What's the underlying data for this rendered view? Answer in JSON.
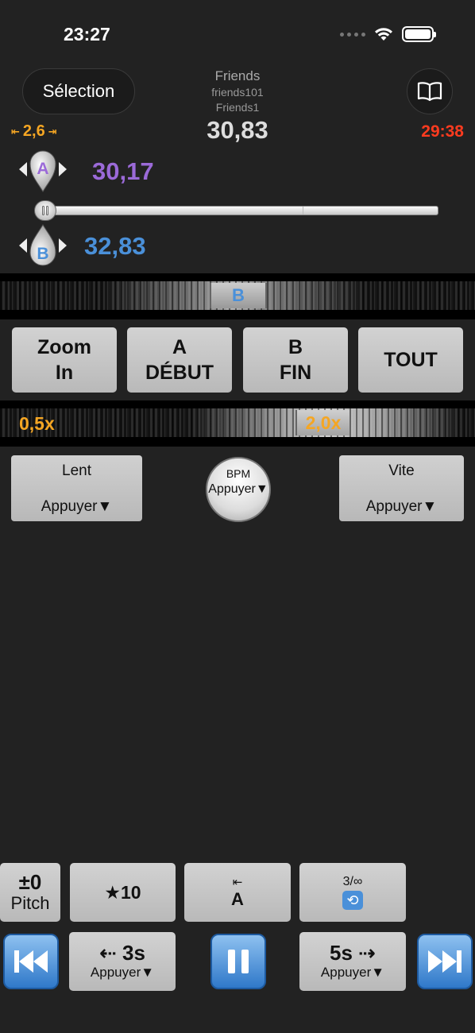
{
  "status": {
    "time": "23:27"
  },
  "header": {
    "select_label": "Sélection",
    "title": "Friends",
    "subtitle1": "friends101",
    "subtitle2": "Friends1",
    "position": "30,83",
    "zoom_step": "2,6",
    "remaining": "29:38",
    "book_icon": "book-icon"
  },
  "markers": {
    "a_letter": "A",
    "a_value": "30,17",
    "b_letter": "B",
    "b_value": "32,83",
    "a_color": "#9b6ad8",
    "b_color": "#4a90d9"
  },
  "slider": {
    "position_fraction": 0.0
  },
  "ab_dial": {
    "label": "B"
  },
  "zoom_buttons": [
    {
      "line1": "Zoom",
      "line2": "In"
    },
    {
      "line1": "A",
      "line2": "DÉBUT"
    },
    {
      "line1": "B",
      "line2": "FIN"
    },
    {
      "line1": "TOUT",
      "line2": ""
    }
  ],
  "speed": {
    "min_label": "0,5x",
    "current": "2,0x",
    "slow_label": "Lent",
    "slow_action": "Appuyer▼",
    "fast_label": "Vite",
    "fast_action": "Appuyer▼",
    "bpm_label": "BPM",
    "bpm_action": "Appuyer▼"
  },
  "bottom": {
    "pitch_value": "±0",
    "pitch_label": "Pitch",
    "favorites": "★10",
    "goto_arrow": "⇤",
    "goto_label": "A",
    "loop_fraction": "3/∞",
    "back_seconds": "⇠ 3s",
    "back_action": "Appuyer▼",
    "forward_seconds": "5s ⇢",
    "forward_action": "Appuyer▼"
  },
  "colors": {
    "accent_orange": "#f5a623",
    "remaining_red": "#ff3b1f",
    "blue": "#2f78c9"
  }
}
